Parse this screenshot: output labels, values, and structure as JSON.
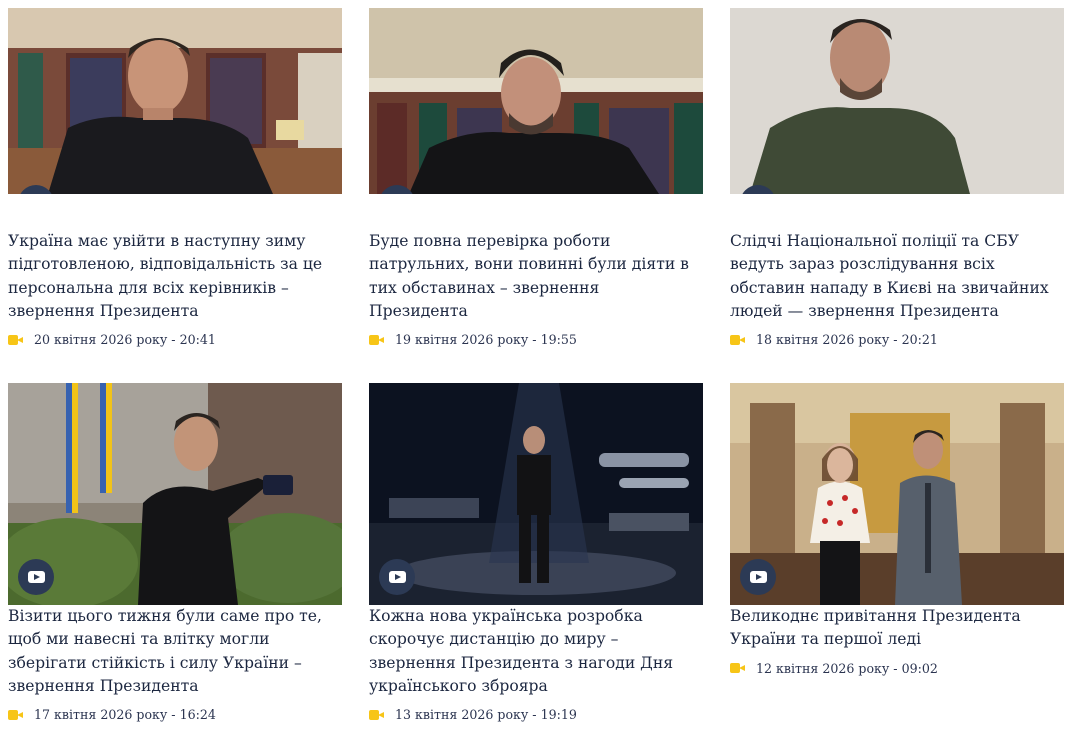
{
  "cards": [
    {
      "title": "Україна має увійти в наступну зиму підготовленою, відповідальність за це персональна для всіх керівників – звернення Президента",
      "date": "20 квітня 2026 року - 20:41"
    },
    {
      "title": "Буде повна перевірка роботи патрульних, вони повинні були діяти в тих обставинах – звернення Президента",
      "date": "19 квітня 2026 року - 19:55"
    },
    {
      "title": "Слідчі Національної поліції та СБУ ведуть зараз розслідування всіх обставин нападу в Києві на звичайних людей — звернення Президента",
      "date": "18 квітня 2026 року - 20:21"
    },
    {
      "title": "Візити цього тижня були саме про те, щоб ми навесні та влітку могли зберігати стійкість і силу України – звернення Президента",
      "date": "17 квітня 2026 року - 16:24"
    },
    {
      "title": "Кожна нова українська розробка скорочує дистанцію до миру – звернення Президента з нагоди Дня українського зброяра",
      "date": "13 квітня 2026 року - 19:19"
    },
    {
      "title": "Великоднє привітання Президента України та першої леді",
      "date": "12 квітня 2026 року - 09:02"
    }
  ],
  "icons": {
    "play": "youtube-play-icon",
    "video": "video-camera-icon"
  },
  "colors": {
    "text": "#1c2740",
    "accent": "#f7c517",
    "badge": "#2c3a55"
  }
}
